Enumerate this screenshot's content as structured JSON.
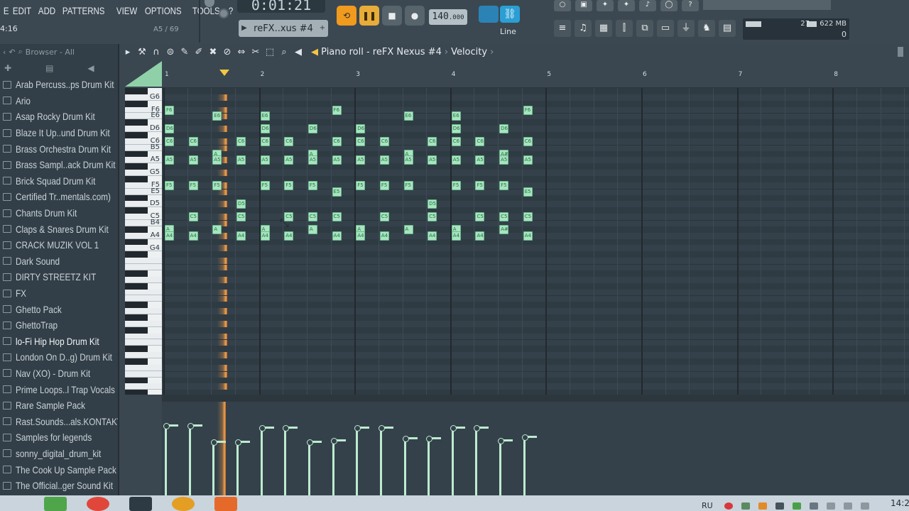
{
  "menu": [
    "E",
    "EDIT",
    "ADD",
    "PATTERNS",
    "VIEW",
    "OPTIONS",
    "TOOLS",
    "?"
  ],
  "hint_time": "4:16",
  "hint_position": "A5 / 69",
  "time_display": "0:01:21",
  "pattern_name": "reFX..xus #4",
  "tempo": "140",
  "tempo_decimal": ".000",
  "snap_mode": "Line",
  "cpu_value": "27",
  "memory": "622 MB",
  "polyphony": "0",
  "browser": {
    "title": "Browser - All",
    "items": [
      "Arab Percuss..ps Drum Kit",
      "Ario",
      "Asap Rocky Drum Kit",
      "Blaze It Up..und Drum Kit",
      "Brass Orchestra Drum Kit",
      "Brass Sampl..ack Drum Kit",
      "Brick Squad Drum Kit",
      "Certified Tr..mentals.com)",
      "Chants Drum Kit",
      "Claps & Snares Drum Kit",
      "CRACK MUZIK VOL 1",
      "Dark Sound",
      "DIRTY STREETZ KIT",
      "FX",
      "Ghetto Pack",
      "GhettoTrap",
      "lo-Fi Hip Hop Drum Kit",
      "London On D..g) Drum Kit",
      "Nav (XO) - Drum Kit",
      "Prime Loops..l Trap Vocals",
      "Rare Sample Pack",
      "Rast.Sounds...als.KONTAKT",
      "Samples for legends",
      "sonny_digital_drum_kit",
      "The Cook Up Sample Pack",
      "The Official..ger Sound Kit"
    ],
    "selected_index": 16
  },
  "piano_roll": {
    "title": "Piano roll - reFX Nexus #4",
    "target": "Velocity",
    "bars": [
      "1",
      "2",
      "3",
      "4",
      "5",
      "6",
      "7",
      "8"
    ],
    "key_labels": [
      "G6",
      "F6",
      "E6",
      "D6",
      "C6",
      "B5",
      "A5",
      "G5",
      "F5",
      "E5",
      "D5",
      "C5",
      "B4",
      "A4",
      "G4"
    ],
    "notes": [
      {
        "p": "F6",
        "s": 0,
        "l": "F6"
      },
      {
        "p": "E6",
        "s": 2,
        "l": "E6"
      },
      {
        "p": "E6",
        "s": 4,
        "l": "E6"
      },
      {
        "p": "F6",
        "s": 7,
        "l": "F6"
      },
      {
        "p": "E6",
        "s": 10,
        "l": "E6"
      },
      {
        "p": "E6",
        "s": 12,
        "l": "E6"
      },
      {
        "p": "F6",
        "s": 15,
        "l": "F6"
      },
      {
        "p": "D6",
        "s": 0,
        "l": "D6"
      },
      {
        "p": "D6",
        "s": 4,
        "l": "D6"
      },
      {
        "p": "D6",
        "s": 6,
        "l": "D6"
      },
      {
        "p": "D6",
        "s": 8,
        "l": "D6"
      },
      {
        "p": "D6",
        "s": 12,
        "l": "D6"
      },
      {
        "p": "D6",
        "s": 14,
        "l": "D6"
      },
      {
        "p": "C6",
        "s": 0,
        "l": "C6"
      },
      {
        "p": "C6",
        "s": 1,
        "l": "C6"
      },
      {
        "p": "C6",
        "s": 3,
        "l": "C6"
      },
      {
        "p": "C6",
        "s": 4,
        "l": "C6"
      },
      {
        "p": "C6",
        "s": 5,
        "l": "C6"
      },
      {
        "p": "C6",
        "s": 7,
        "l": "C6"
      },
      {
        "p": "C6",
        "s": 8,
        "l": "C6"
      },
      {
        "p": "C6",
        "s": 9,
        "l": "C6"
      },
      {
        "p": "C6",
        "s": 11,
        "l": "C6"
      },
      {
        "p": "C6",
        "s": 12,
        "l": "C6"
      },
      {
        "p": "C6",
        "s": 13,
        "l": "C6"
      },
      {
        "p": "C6",
        "s": 15,
        "l": "C6"
      },
      {
        "p": "A#5",
        "s": 2,
        "l": "A"
      },
      {
        "p": "A#5",
        "s": 6,
        "l": "A"
      },
      {
        "p": "A#5",
        "s": 10,
        "l": "A"
      },
      {
        "p": "A#5",
        "s": 14,
        "l": "A#5"
      },
      {
        "p": "A5",
        "s": 0,
        "l": "A5"
      },
      {
        "p": "A5",
        "s": 1,
        "l": "A5"
      },
      {
        "p": "A5",
        "s": 2,
        "l": "A5"
      },
      {
        "p": "A5",
        "s": 3,
        "l": "A5"
      },
      {
        "p": "A5",
        "s": 4,
        "l": "A5"
      },
      {
        "p": "A5",
        "s": 5,
        "l": "A5"
      },
      {
        "p": "A5",
        "s": 6,
        "l": "A5"
      },
      {
        "p": "A5",
        "s": 7,
        "l": "A5"
      },
      {
        "p": "A5",
        "s": 8,
        "l": "A5"
      },
      {
        "p": "A5",
        "s": 9,
        "l": "A5"
      },
      {
        "p": "A5",
        "s": 10,
        "l": "A5"
      },
      {
        "p": "A5",
        "s": 11,
        "l": "A5"
      },
      {
        "p": "A5",
        "s": 12,
        "l": "A5"
      },
      {
        "p": "A5",
        "s": 13,
        "l": "A5"
      },
      {
        "p": "A5",
        "s": 14,
        "l": "A5"
      },
      {
        "p": "A5",
        "s": 15,
        "l": "A5"
      },
      {
        "p": "F5",
        "s": 0,
        "l": "F5"
      },
      {
        "p": "F5",
        "s": 1,
        "l": "F5"
      },
      {
        "p": "F5",
        "s": 2,
        "l": "F5"
      },
      {
        "p": "F5",
        "s": 4,
        "l": "F5"
      },
      {
        "p": "F5",
        "s": 5,
        "l": "F5"
      },
      {
        "p": "F5",
        "s": 6,
        "l": "F5"
      },
      {
        "p": "F5",
        "s": 8,
        "l": "F5"
      },
      {
        "p": "F5",
        "s": 9,
        "l": "F5"
      },
      {
        "p": "F5",
        "s": 10,
        "l": "F5"
      },
      {
        "p": "F5",
        "s": 12,
        "l": "F5"
      },
      {
        "p": "F5",
        "s": 13,
        "l": "F5"
      },
      {
        "p": "F5",
        "s": 14,
        "l": "F5"
      },
      {
        "p": "E5",
        "s": 7,
        "l": "E5"
      },
      {
        "p": "E5",
        "s": 15,
        "l": "E5"
      },
      {
        "p": "D5",
        "s": 3,
        "l": "D5"
      },
      {
        "p": "D5",
        "s": 11,
        "l": "D5"
      },
      {
        "p": "C5",
        "s": 1,
        "l": "C5"
      },
      {
        "p": "C5",
        "s": 3,
        "l": "C5"
      },
      {
        "p": "C5",
        "s": 5,
        "l": "C5"
      },
      {
        "p": "C5",
        "s": 6,
        "l": "C5"
      },
      {
        "p": "C5",
        "s": 7,
        "l": "C5"
      },
      {
        "p": "C5",
        "s": 9,
        "l": "C5"
      },
      {
        "p": "C5",
        "s": 11,
        "l": "C5"
      },
      {
        "p": "C5",
        "s": 13,
        "l": "C5"
      },
      {
        "p": "C5",
        "s": 14,
        "l": "C5"
      },
      {
        "p": "C5",
        "s": 15,
        "l": "C5"
      },
      {
        "p": "A#4",
        "s": 0,
        "l": "A"
      },
      {
        "p": "A#4",
        "s": 2,
        "l": "A"
      },
      {
        "p": "A#4",
        "s": 4,
        "l": "A"
      },
      {
        "p": "A#4",
        "s": 6,
        "l": "A"
      },
      {
        "p": "A#4",
        "s": 8,
        "l": "A"
      },
      {
        "p": "A#4",
        "s": 10,
        "l": "A"
      },
      {
        "p": "A#4",
        "s": 12,
        "l": "A"
      },
      {
        "p": "A#4",
        "s": 14,
        "l": "A#4"
      },
      {
        "p": "A4",
        "s": 0,
        "l": "A4"
      },
      {
        "p": "A4",
        "s": 1,
        "l": "A4"
      },
      {
        "p": "A4",
        "s": 3,
        "l": "A4"
      },
      {
        "p": "A4",
        "s": 4,
        "l": "A4"
      },
      {
        "p": "A4",
        "s": 5,
        "l": "A4"
      },
      {
        "p": "A4",
        "s": 7,
        "l": "A4"
      },
      {
        "p": "A4",
        "s": 8,
        "l": "A4"
      },
      {
        "p": "A4",
        "s": 9,
        "l": "A4"
      },
      {
        "p": "A4",
        "s": 11,
        "l": "A4"
      },
      {
        "p": "A4",
        "s": 12,
        "l": "A4"
      },
      {
        "p": "A4",
        "s": 13,
        "l": "A4"
      },
      {
        "p": "A4",
        "s": 15,
        "l": "A4"
      }
    ],
    "velocities": [
      0.8,
      0.8,
      0.62,
      0.62,
      0.78,
      0.78,
      0.62,
      0.64,
      0.78,
      0.78,
      0.66,
      0.66,
      0.78,
      0.78,
      0.64,
      0.68
    ]
  },
  "taskbar": {
    "language": "RU",
    "clock": "14:2"
  }
}
